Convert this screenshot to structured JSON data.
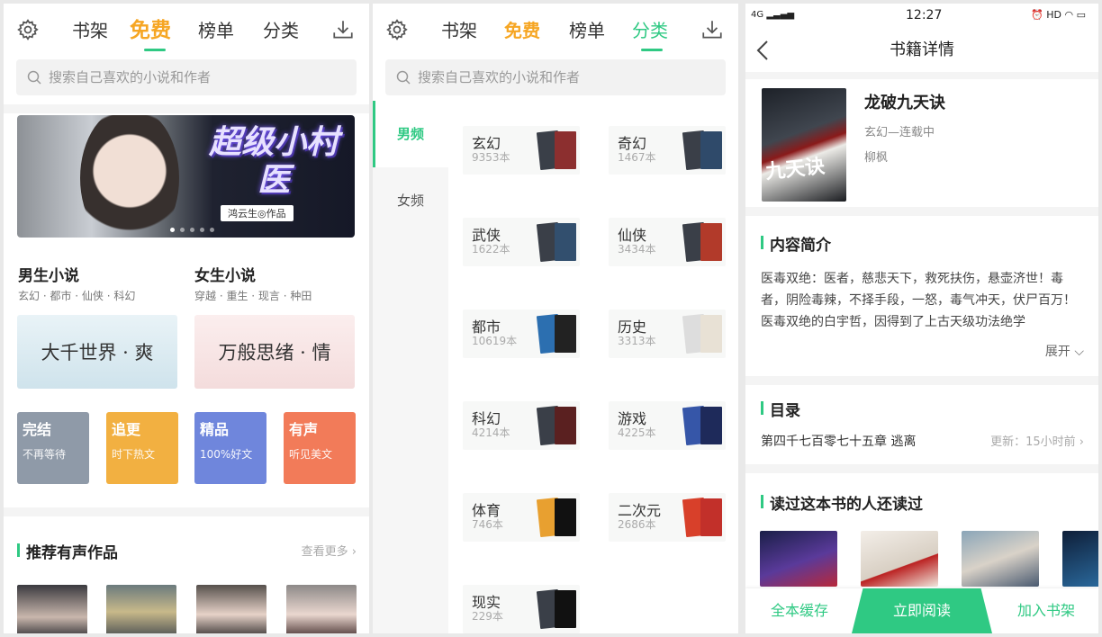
{
  "colors": {
    "accent": "#2fc983",
    "free": "#f6a623"
  },
  "panel1": {
    "tabs": [
      "书架",
      "免费",
      "榜单",
      "分类"
    ],
    "search_placeholder": "搜索自己喜欢的小说和作者",
    "banner": {
      "title": "超级小村医",
      "byline": "鸿云生◎作品"
    },
    "male": {
      "title": "男生小说",
      "sub": "玄幻 · 都市 · 仙侠 · 科幻"
    },
    "female": {
      "title": "女生小说",
      "sub": "穿越 · 重生 · 现言 · 种田"
    },
    "themes": [
      "大千世界 · 爽",
      "万般思绪 · 情"
    ],
    "cards": [
      {
        "t": "完结",
        "s": "不再等待",
        "color": "#8f9aa8"
      },
      {
        "t": "追更",
        "s": "时下热文",
        "color": "#f2b041"
      },
      {
        "t": "精品",
        "s": "100%好文",
        "color": "#6f86dc"
      },
      {
        "t": "有声",
        "s": "听见美文",
        "color": "#f27b59"
      }
    ],
    "audio_title": "推荐有声作品",
    "more": "查看更多"
  },
  "panel2": {
    "tabs": [
      "书架",
      "免费",
      "榜单",
      "分类"
    ],
    "search_placeholder": "搜索自己喜欢的小说和作者",
    "side": [
      "男频",
      "女频"
    ],
    "categories": [
      {
        "n": "玄幻",
        "c": "9353本"
      },
      {
        "n": "奇幻",
        "c": "1467本"
      },
      {
        "n": "武侠",
        "c": "1622本"
      },
      {
        "n": "仙侠",
        "c": "3434本"
      },
      {
        "n": "都市",
        "c": "10619本"
      },
      {
        "n": "历史",
        "c": "3313本"
      },
      {
        "n": "科幻",
        "c": "4214本"
      },
      {
        "n": "游戏",
        "c": "4225本"
      },
      {
        "n": "体育",
        "c": "746本"
      },
      {
        "n": "二次元",
        "c": "2686本"
      },
      {
        "n": "现实",
        "c": "229本"
      }
    ]
  },
  "panel3": {
    "status": {
      "net": "4G",
      "time": "12:27",
      "hd": "HD"
    },
    "header": "书籍详情",
    "book": {
      "title": "龙破九天诀",
      "genre": "玄幻—连载中",
      "author": "柳枫",
      "cover_text": "九天诀"
    },
    "intro_title": "内容简介",
    "intro": "医毒双绝：医者，慈悲天下，救死扶伤，悬壶济世！毒者，阴险毒辣，不择手段，一怒，毒气冲天，伏尸百万！ 医毒双绝的白宇哲，因得到了上古天级功法绝学",
    "expand": "展开",
    "toc_title": "目录",
    "chapter": "第四千七百零七十五章 逃离",
    "update": "更新：15小时前",
    "also_title": "读过这本书的人还读过",
    "actions": [
      "全本缓存",
      "立即阅读",
      "加入书架"
    ]
  }
}
